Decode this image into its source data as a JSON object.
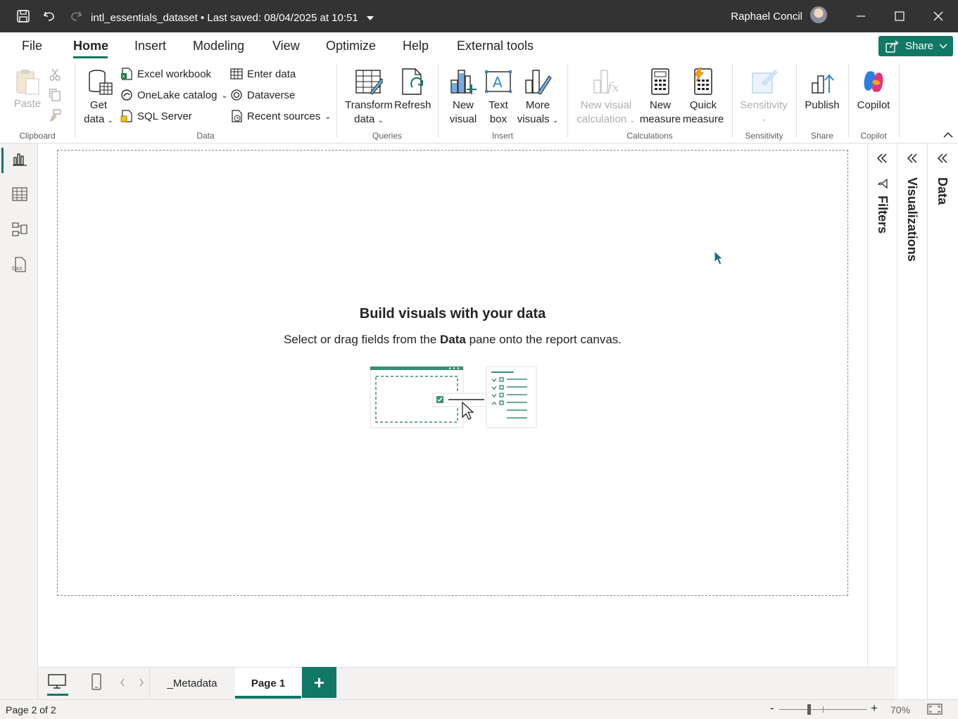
{
  "title_bar": {
    "file_name": "intl_essentials_dataset",
    "saved_status": "• Last saved: 08/04/2025 at 10:51",
    "user_name": "Raphael Concil"
  },
  "menu": {
    "tabs": [
      "File",
      "Home",
      "Insert",
      "Modeling",
      "View",
      "Optimize",
      "Help",
      "External tools"
    ],
    "active": "Home",
    "share_label": "Share"
  },
  "ribbon": {
    "clipboard": {
      "paste": "Paste",
      "group": "Clipboard"
    },
    "data": {
      "get_data_1": "Get",
      "get_data_2": "data",
      "excel": "Excel workbook",
      "onelake": "OneLake catalog",
      "sql": "SQL Server",
      "enter_data": "Enter data",
      "dataverse": "Dataverse",
      "recent": "Recent sources",
      "group": "Data"
    },
    "queries": {
      "transform_1": "Transform",
      "transform_2": "data",
      "refresh": "Refresh",
      "group": "Queries"
    },
    "insert": {
      "new_visual_1": "New",
      "new_visual_2": "visual",
      "text_box_1": "Text",
      "text_box_2": "box",
      "more_visuals_1": "More",
      "more_visuals_2": "visuals",
      "group": "Insert"
    },
    "calculations": {
      "new_visual_calc_1": "New visual",
      "new_visual_calc_2": "calculation",
      "new_measure_1": "New",
      "new_measure_2": "measure",
      "quick_measure_1": "Quick",
      "quick_measure_2": "measure",
      "group": "Calculations"
    },
    "sensitivity": {
      "label": "Sensitivity",
      "group": "Sensitivity"
    },
    "share": {
      "publish": "Publish",
      "group": "Share"
    },
    "copilot": {
      "label": "Copilot",
      "group": "Copilot"
    }
  },
  "canvas": {
    "heading": "Build visuals with your data",
    "desc_before": "Select or drag fields from the ",
    "desc_bold": "Data",
    "desc_after": " pane onto the report canvas."
  },
  "panes": {
    "filters": "Filters",
    "visualizations": "Visualizations",
    "data": "Data"
  },
  "pages": {
    "tabs": [
      "_Metadata",
      "Page 1"
    ],
    "active": "Page 1",
    "add": "+"
  },
  "status": {
    "page_info": "Page 2 of 2",
    "zoom": "70%",
    "zoom_fraction": 0.7
  },
  "colors": {
    "accent": "#117865",
    "titlebar": "#333333"
  }
}
